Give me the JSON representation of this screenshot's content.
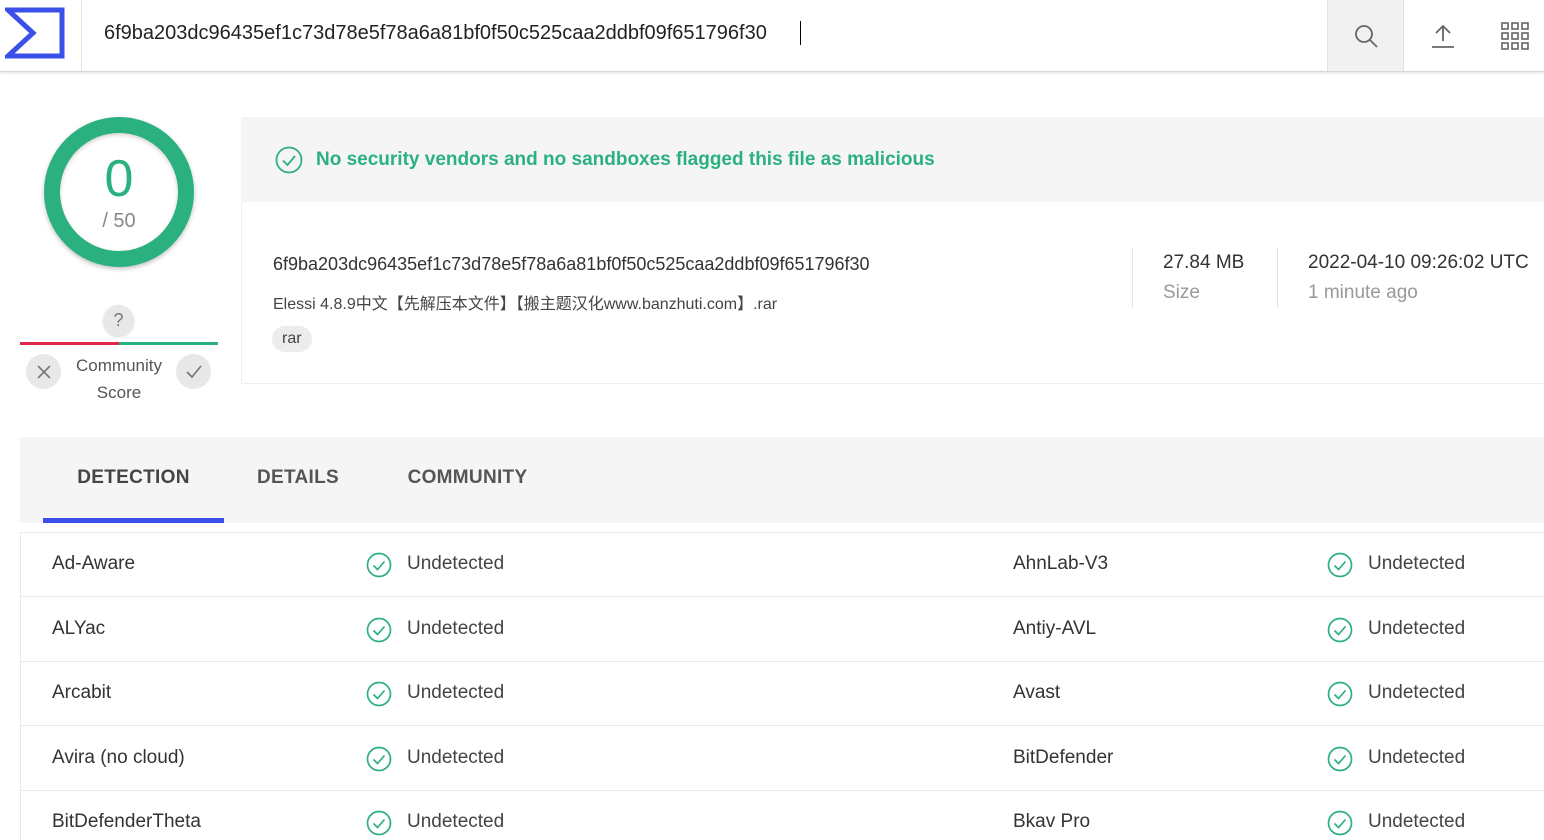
{
  "search": {
    "value": "6f9ba203dc96435ef1c73d78e5f78a6a81bf0f50c525caa2ddbf09f651796f30"
  },
  "colors": {
    "accent": "#3b50e8",
    "clean": "#2bb07f",
    "malicious": "#e0264a"
  },
  "score": {
    "value": "0",
    "total": "/ 50"
  },
  "community": {
    "question": "?",
    "label_line1": "Community",
    "label_line2": "Score"
  },
  "banner": {
    "text": "No security vendors and no sandboxes flagged this file as malicious"
  },
  "file": {
    "hash": "6f9ba203dc96435ef1c73d78e5f78a6a81bf0f50c525caa2ddbf09f651796f30",
    "name": "Elessi 4.8.9中文【先解压本文件】【搬主题汉化www.banzhuti.com】.rar",
    "tag": "rar",
    "size": "27.84 MB",
    "size_label": "Size",
    "date": "2022-04-10 09:26:02 UTC",
    "date_relative": "1 minute ago"
  },
  "tabs": {
    "detection": "DETECTION",
    "details": "DETAILS",
    "community": "COMMUNITY"
  },
  "detections": [
    {
      "left": {
        "vendor": "Ad-Aware",
        "result": "Undetected"
      },
      "right": {
        "vendor": "AhnLab-V3",
        "result": "Undetected"
      }
    },
    {
      "left": {
        "vendor": "ALYac",
        "result": "Undetected"
      },
      "right": {
        "vendor": "Antiy-AVL",
        "result": "Undetected"
      }
    },
    {
      "left": {
        "vendor": "Arcabit",
        "result": "Undetected"
      },
      "right": {
        "vendor": "Avast",
        "result": "Undetected"
      }
    },
    {
      "left": {
        "vendor": "Avira (no cloud)",
        "result": "Undetected"
      },
      "right": {
        "vendor": "BitDefender",
        "result": "Undetected"
      }
    },
    {
      "left": {
        "vendor": "BitDefenderTheta",
        "result": "Undetected"
      },
      "right": {
        "vendor": "Bkav Pro",
        "result": "Undetected"
      }
    }
  ]
}
